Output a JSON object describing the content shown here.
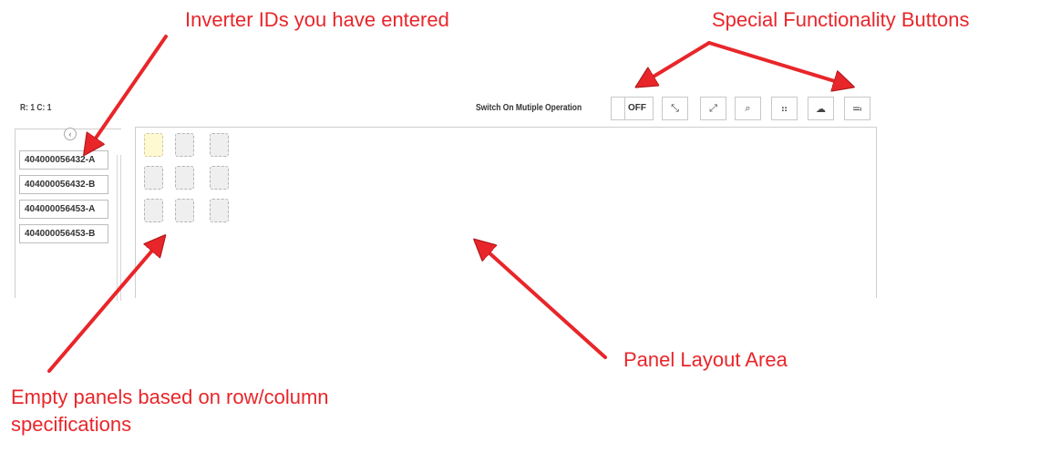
{
  "annotations": {
    "inverter_ids": "Inverter IDs you have entered",
    "special_buttons": "Special Functionality Buttons",
    "panel_layout": "Panel Layout Area",
    "empty_panels_line1": "Empty panels based on row/column",
    "empty_panels_line2": "specifications"
  },
  "toolbar": {
    "rc_label": "R: 1 C: 1",
    "switch_label": "Switch On Mutiple Operation",
    "toggle_state": "OFF",
    "buttons": [
      {
        "name": "compress-icon",
        "glyph": "⤡"
      },
      {
        "name": "expand-icon",
        "glyph": "⤢"
      },
      {
        "name": "search-icon",
        "glyph": "⌕"
      },
      {
        "name": "grid-icon",
        "glyph": "⠶"
      },
      {
        "name": "cloud-upload-icon",
        "glyph": "☁"
      },
      {
        "name": "align-icon",
        "glyph": "≕"
      }
    ]
  },
  "sidebar": {
    "collapse_glyph": "‹",
    "inverters": [
      "404000056432-A",
      "404000056432-B",
      "404000056453-A",
      "404000056453-B"
    ]
  },
  "grid": {
    "rows": 3,
    "cols": 3,
    "active_cell": [
      0,
      0
    ]
  },
  "colors": {
    "annotation": "#e8262a",
    "active_panel": "#fff9d2",
    "empty_panel": "#efefef"
  }
}
